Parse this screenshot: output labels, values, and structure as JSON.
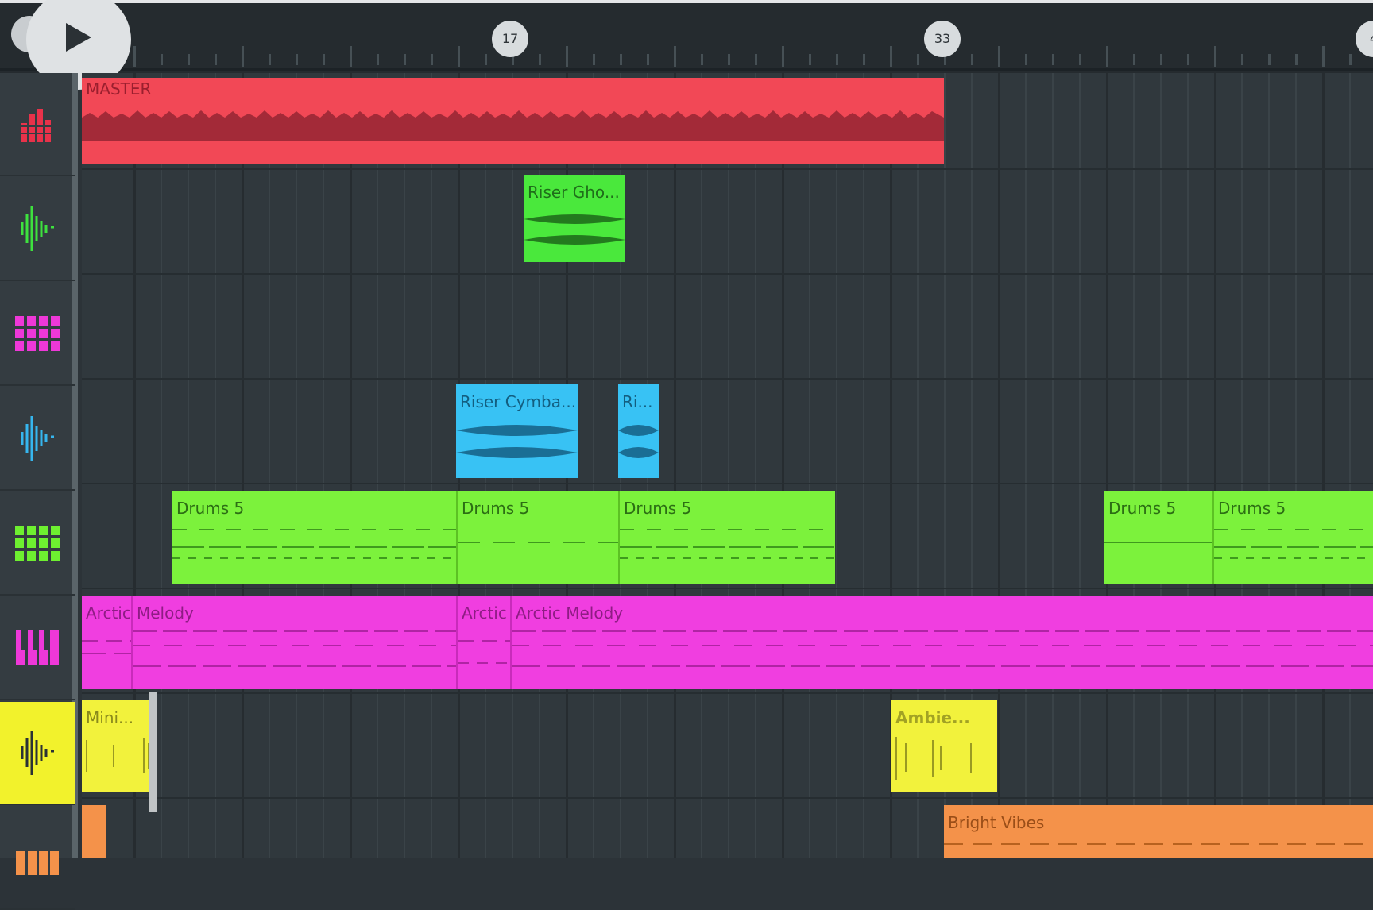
{
  "transport": {
    "play_icon": "play-icon"
  },
  "timeline": {
    "markers": [
      "17",
      "33",
      "4"
    ]
  },
  "tracks": [
    {
      "icon": "mixer-icon",
      "color": "#e8324a"
    },
    {
      "icon": "audio-wave-icon",
      "color": "#3ee23e"
    },
    {
      "icon": "pattern-grid-icon",
      "color": "#ee38d8"
    },
    {
      "icon": "audio-wave-icon",
      "color": "#36b6ee"
    },
    {
      "icon": "pattern-grid-icon",
      "color": "#6ef030"
    },
    {
      "icon": "piano-keys-icon",
      "color": "#ee38d8"
    },
    {
      "icon": "audio-wave-icon",
      "color": "#2b3135",
      "active": true
    },
    {
      "icon": "piano-keys-icon",
      "color": "#ee38d8"
    }
  ],
  "clips": {
    "master": "MASTER",
    "riser_ghost": "Riser Gho...",
    "riser_cymbal": "Riser Cymba...",
    "riser_short": "Ri...",
    "drums_1": "Drums 5",
    "drums_2": "Drums 5",
    "drums_3": "Drums 5",
    "drums_4": "Drums 5",
    "drums_5": "Drums 5",
    "arctic_1": "Arctic",
    "arctic_2": "Melody",
    "arctic_3": "Arctic",
    "arctic_4": "Arctic Melody",
    "mini": "Mini...",
    "ambience": "Ambie...",
    "bright_vibes": "Bright Vibes"
  },
  "colors": {
    "master": "#f24856",
    "riser_ghost": "#4ae83c",
    "riser_cymbal": "#38c2f4",
    "drums": "#7cf23c",
    "arctic": "#f03ee0",
    "mini": "#f2f23c",
    "bright_vibes": "#f4924a"
  }
}
